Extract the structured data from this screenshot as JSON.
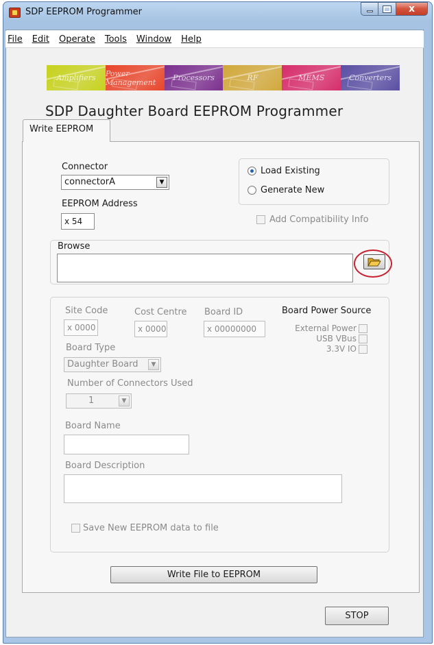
{
  "window": {
    "title": "SDP EEPROM Programmer",
    "close_glyph": "x"
  },
  "menu": [
    "File",
    "Edit",
    "Operate",
    "Tools",
    "Window",
    "Help"
  ],
  "banner": {
    "segments": [
      "Amplifiers",
      "Power Management",
      "Processors",
      "RF",
      "MEMS",
      "Converters"
    ],
    "colors": [
      "#c7d21e",
      "#e8452a",
      "#7b2f8e",
      "#d1a83b",
      "#d62d6b",
      "#5a4fa3"
    ]
  },
  "main_title": "SDP Daughter Board EEPROM Programmer",
  "tab": {
    "label": "Write EEPROM"
  },
  "connector": {
    "label": "Connector",
    "value": "connectorA",
    "arrow": "▼"
  },
  "eeprom_address": {
    "label": "EEPROM Address",
    "value": "x 54"
  },
  "mode": {
    "load_existing": "Load Existing",
    "generate_new": "Generate New",
    "selected": "Load Existing"
  },
  "add_compat": {
    "label": "Add Compatibility Info"
  },
  "browse": {
    "label": "Browse",
    "path": "",
    "folder_glyph": "folder-open-icon"
  },
  "board": {
    "site_code": {
      "label": "Site Code",
      "value": "x 0000"
    },
    "cost_centre": {
      "label": "Cost Centre",
      "value": "x 0000"
    },
    "board_id": {
      "label": "Board ID",
      "value": "x 00000000"
    },
    "power_source": {
      "label": "Board Power Source",
      "options": [
        "External Power",
        "USB VBus",
        "3.3V IO"
      ]
    },
    "board_type": {
      "label": "Board Type",
      "value": "Daughter Board",
      "arrow": "▼"
    },
    "connectors_used": {
      "label": "Number of Connectors Used",
      "value": "1",
      "arrow": "▼"
    },
    "board_name": {
      "label": "Board Name",
      "value": ""
    },
    "board_description": {
      "label": "Board Description",
      "value": ""
    },
    "save_file": {
      "label": "Save New EEPROM data to file"
    }
  },
  "write_button": "Write File to EEPROM",
  "stop_button": "STOP"
}
